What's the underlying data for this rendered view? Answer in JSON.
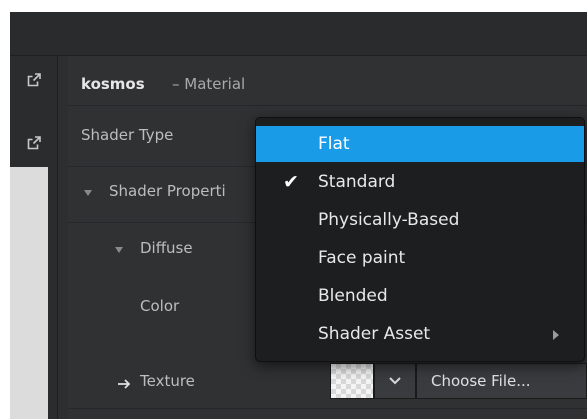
{
  "object": {
    "name": "kosmos",
    "type_label": "– Material"
  },
  "rows": {
    "shader_type": "Shader Type",
    "shader_properties": "Shader Properti",
    "diffuse": "Diffuse",
    "color": "Color",
    "texture": "Texture"
  },
  "texture": {
    "choose_file": "Choose File..."
  },
  "menu": {
    "items": [
      {
        "label": "Flat",
        "highlighted": true,
        "checked": false
      },
      {
        "label": "Standard",
        "highlighted": false,
        "checked": true
      },
      {
        "label": "Physically-Based",
        "highlighted": false,
        "checked": false
      },
      {
        "label": "Face paint",
        "highlighted": false,
        "checked": false
      },
      {
        "label": "Blended",
        "highlighted": false,
        "checked": false
      },
      {
        "label": "Shader Asset",
        "highlighted": false,
        "checked": false,
        "has_submenu": true
      }
    ],
    "check_glyph": "✔"
  },
  "colors": {
    "highlight": "#1a9be8",
    "background": "#303133",
    "menu_bg": "#1d1e20"
  },
  "icons": [
    "external-link-icon",
    "arrow-right-icon",
    "chevron-down-icon",
    "triangle-down-icon",
    "submenu-arrow-icon"
  ]
}
